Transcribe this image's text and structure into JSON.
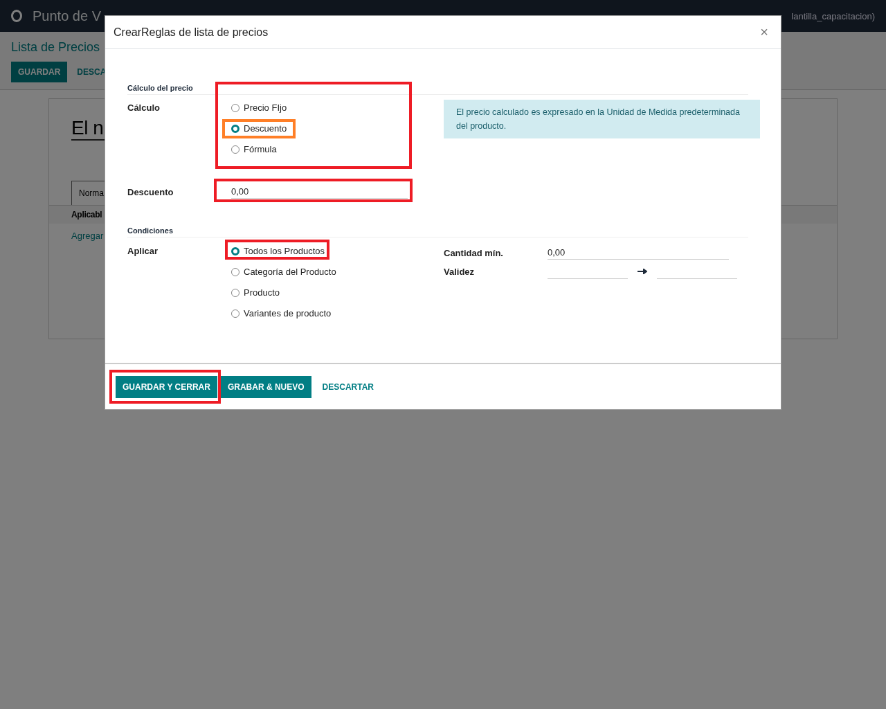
{
  "navbar": {
    "app_name": "Punto de V",
    "user": "lantilla_capacitacion)"
  },
  "control_panel": {
    "breadcrumb": "Lista de Precios",
    "buttons": [
      {
        "label": "GUARDAR",
        "kind": "primary"
      },
      {
        "label": "DESCA",
        "kind": "link"
      }
    ]
  },
  "form": {
    "title": "El n",
    "tab": "Norma",
    "column_header": "Aplicabl",
    "add_link": "Agregar"
  },
  "dialog": {
    "title": "CrearReglas de lista de precios",
    "close": "×",
    "price_section": {
      "title": "Cálculo del precio",
      "calc_label": "Cálculo",
      "highlighted": true,
      "options": [
        {
          "label": "Precio FIjo",
          "selected": false,
          "highlighted": false
        },
        {
          "label": "Descuento",
          "selected": true,
          "highlighted": true
        },
        {
          "label": "Fórmula",
          "selected": false,
          "highlighted": false
        }
      ],
      "discount_label": "Descuento",
      "discount_value": "0,00",
      "discount_highlighted": true,
      "info": "El precio calculado es expresado en la Unidad de Medida predeterminada del producto."
    },
    "conditions": {
      "title": "Condiciones",
      "apply_label": "Aplicar",
      "options": [
        {
          "label": "Todos los Productos",
          "selected": true,
          "highlighted": true
        },
        {
          "label": "Categoría del Producto",
          "selected": false,
          "highlighted": false
        },
        {
          "label": "Producto",
          "selected": false,
          "highlighted": false
        },
        {
          "label": "Variantes de producto",
          "selected": false,
          "highlighted": false
        }
      ],
      "min_qty_label": "Cantidad mín.",
      "min_qty_value": "0,00",
      "validity_label": "Validez"
    },
    "footer_buttons": [
      {
        "label": "GUARDAR Y CERRAR",
        "kind": "primary",
        "highlighted": true
      },
      {
        "label": "GRABAR & NUEVO",
        "kind": "primary",
        "highlighted": false
      },
      {
        "label": "DESCARTAR",
        "kind": "link",
        "highlighted": false
      }
    ]
  }
}
